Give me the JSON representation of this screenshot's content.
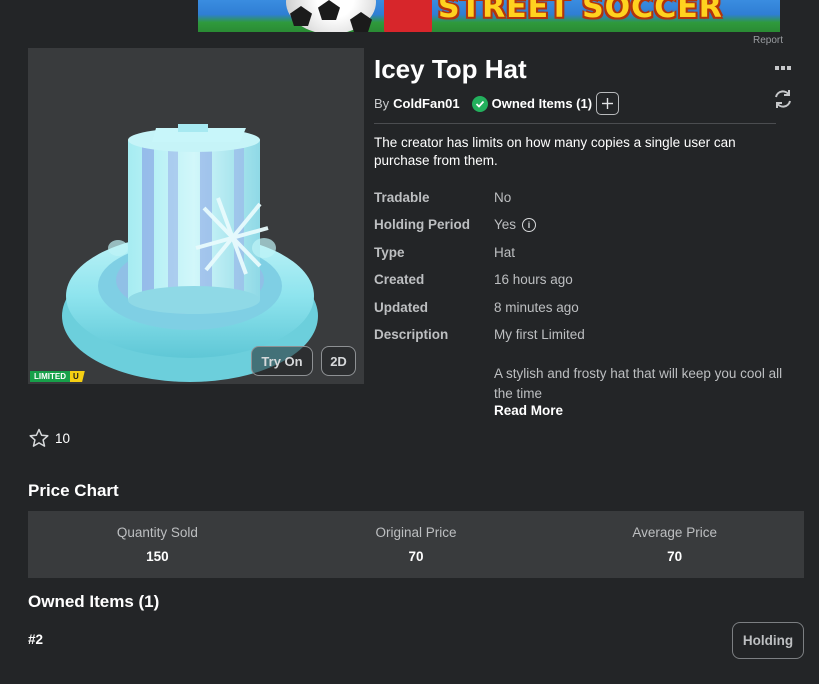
{
  "ad": {
    "title": "STREET SOCCER",
    "report_label": "Report"
  },
  "item": {
    "name": "Icey Top Hat",
    "by_label": "By",
    "creator": "ColdFan01",
    "owned_label": "Owned Items (1)",
    "notice": "The creator has limits on how many copies a single user can purchase from them.",
    "badge_limited": "LIMITED",
    "badge_u": "U",
    "try_on_label": "Try On",
    "view_2d_label": "2D",
    "details": [
      {
        "label": "Tradable",
        "value": "No"
      },
      {
        "label": "Holding Period",
        "value": "Yes",
        "icon": "info-icon"
      },
      {
        "label": "Type",
        "value": "Hat"
      },
      {
        "label": "Created",
        "value": "16 hours ago"
      },
      {
        "label": "Updated",
        "value": "8 minutes ago"
      },
      {
        "label": "Description",
        "value": "My first Limited"
      }
    ],
    "description_extra": "A stylish and frosty hat that will keep you cool all the time",
    "read_more_label": "Read More",
    "favorites": "10"
  },
  "price_chart": {
    "title": "Price Chart",
    "stats": [
      {
        "label": "Quantity Sold",
        "value": "150"
      },
      {
        "label": "Original Price",
        "value": "70"
      },
      {
        "label": "Average Price",
        "value": "70"
      }
    ]
  },
  "owned_items": {
    "title": "Owned Items (1)",
    "rows": [
      {
        "serial": "#2",
        "status": "Holding"
      }
    ]
  },
  "colors": {
    "background": "#232527",
    "panel": "#393b3d",
    "verified_green": "#23b05d",
    "limited_green": "#17a04a",
    "limited_yellow": "#f5cf13"
  }
}
